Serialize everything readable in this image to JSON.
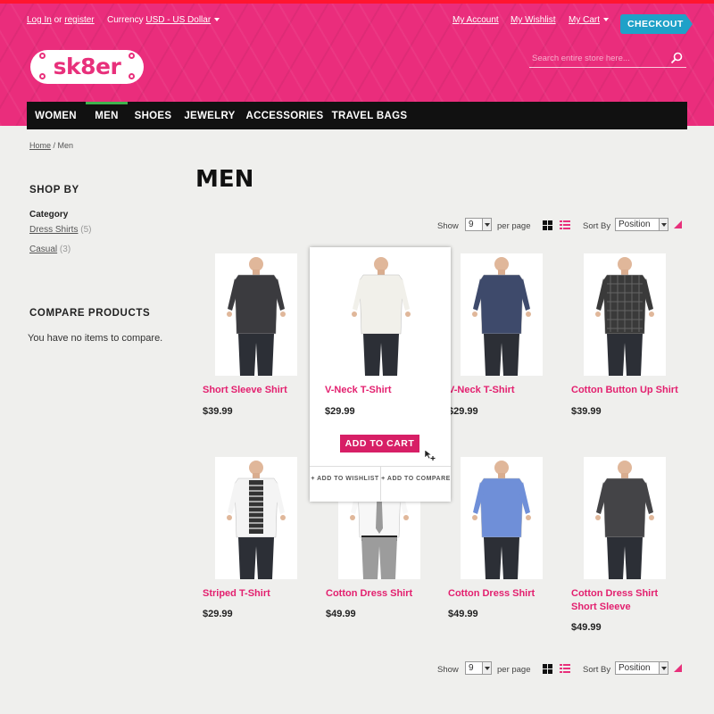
{
  "header": {
    "login": "Log In",
    "or": "or",
    "register": "register",
    "currency_label": "Currency",
    "currency_value": "USD - US Dollar",
    "my_account": "My Account",
    "my_wishlist": "My Wishlist",
    "my_cart": "My Cart",
    "checkout": "CHECKOUT",
    "logo": "sk8er",
    "search_placeholder": "Search entire store here...",
    "icons": {
      "search": "search-icon",
      "dropdown": "caret-down-icon"
    },
    "colors": {
      "brand": "#ea2d7c",
      "nav": "#111111",
      "active": "#3fb34f",
      "checkout": "#1fa1c8"
    }
  },
  "nav": [
    {
      "label": "WOMEN"
    },
    {
      "label": "MEN"
    },
    {
      "label": "SHOES"
    },
    {
      "label": "JEWELRY"
    },
    {
      "label": "ACCESSORIES"
    },
    {
      "label": "TRAVEL BAGS"
    }
  ],
  "nav_active": "MEN",
  "breadcrumb": {
    "home": "Home",
    "sep": " / ",
    "current": "Men"
  },
  "sidebar": {
    "shop_by": "SHOP BY",
    "category": "Category",
    "items": [
      {
        "label": "Dress Shirts",
        "count": "(5)"
      },
      {
        "label": "Casual",
        "count": "(3)"
      }
    ],
    "compare_title": "COMPARE PRODUCTS",
    "compare_empty": "You have no items to compare."
  },
  "page_title": "MEN",
  "toolbar": {
    "show": "Show",
    "per_page_value": "9",
    "per_page": "per page",
    "sort_by": "Sort By",
    "sort_value": "Position"
  },
  "products": [
    {
      "name": "Short Sleeve Shirt",
      "price": "$39.99",
      "shirt": "#3b3b3f",
      "pattern": "none"
    },
    {
      "name": "V-Neck T-Shirt",
      "price": "$29.99",
      "shirt": "#f1f0ea",
      "pattern": "none"
    },
    {
      "name": "V-Neck T-Shirt",
      "price": "$29.99",
      "shirt": "#3e4a6b",
      "pattern": "none"
    },
    {
      "name": "Cotton Button Up Shirt",
      "price": "$39.99",
      "shirt": "#3a3a3a",
      "pattern": "plaid"
    },
    {
      "name": "Striped T-Shirt",
      "price": "$29.99",
      "shirt": "#f4f4f4",
      "pattern": "blazer"
    },
    {
      "name": "Cotton Dress Shirt",
      "price": "$49.99",
      "shirt": "#f7f7f7",
      "pattern": "tie"
    },
    {
      "name": "Cotton Dress Shirt",
      "price": "$49.99",
      "shirt": "#6f8fd8",
      "pattern": "none"
    },
    {
      "name": "Cotton Dress Shirt Short Sleeve",
      "price": "$49.99",
      "shirt": "#444447",
      "pattern": "none"
    }
  ],
  "hover": {
    "add_to_cart": "ADD TO CART",
    "add_to_wishlist": "+ ADD TO WISHLIST",
    "add_to_compare": "+ ADD TO COMPARE"
  }
}
